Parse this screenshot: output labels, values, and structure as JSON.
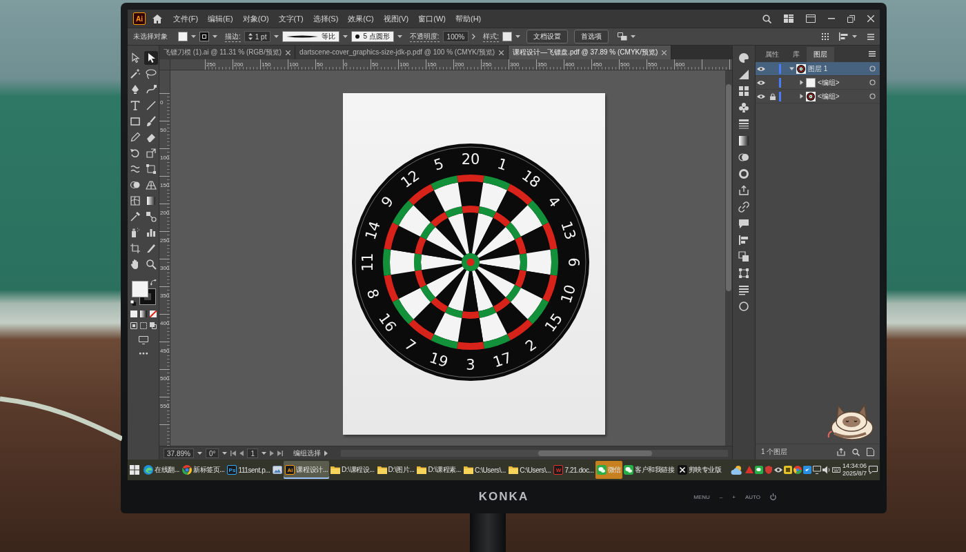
{
  "menubar": {
    "logo": "Ai",
    "menus": [
      "文件(F)",
      "编辑(E)",
      "对象(O)",
      "文字(T)",
      "选择(S)",
      "效果(C)",
      "视图(V)",
      "窗口(W)",
      "帮助(H)"
    ]
  },
  "control_bar": {
    "selection": "未选择对象",
    "stroke_label": "描边:",
    "stroke_weight": "1 pt",
    "stroke_profile": "等比",
    "brush": "5 点圆形",
    "opacity_label": "不透明度:",
    "opacity": "100%",
    "style_label": "样式:",
    "buttons": [
      "文档设置",
      "首选项"
    ]
  },
  "toolbar": {
    "tools": [
      {
        "selected": false
      },
      {
        "selected": true
      },
      {
        "selected": false
      },
      {
        "selected": false
      },
      {
        "selected": false
      },
      {
        "selected": false
      },
      {
        "selected": false
      },
      {
        "selected": false
      },
      {
        "selected": false
      },
      {
        "selected": false
      },
      {
        "selected": false
      },
      {
        "selected": false
      },
      {
        "selected": false
      },
      {
        "selected": false
      },
      {
        "selected": false
      },
      {
        "selected": false
      },
      {
        "selected": false
      },
      {
        "selected": false
      },
      {
        "selected": false
      },
      {
        "selected": false
      },
      {
        "selected": false
      },
      {
        "selected": false
      },
      {
        "selected": false
      },
      {
        "selected": false
      },
      {
        "selected": false
      },
      {
        "selected": false
      },
      {
        "selected": false
      },
      {
        "selected": false
      }
    ]
  },
  "documents": [
    {
      "title": "飞镖刀模 (1).ai @ 11.31 % (RGB/预览)",
      "selected": false
    },
    {
      "title": "dartscene-cover_graphics-size-jdk-p.pdf @ 100 % (CMYK/预览)",
      "selected": false
    },
    {
      "title": "课程设计—飞镖盘.pdf @ 37.89 % (CMYK/预览)",
      "selected": true
    }
  ],
  "rulers": {
    "horizontal": [
      "250",
      "200",
      "150",
      "100",
      "50",
      "0",
      "50",
      "100",
      "150",
      "200",
      "250",
      "300",
      "350",
      "400",
      "450",
      "500",
      "550",
      "600"
    ],
    "vertical": [
      "0",
      "50",
      "100",
      "150",
      "200",
      "250",
      "300",
      "350",
      "400",
      "450",
      "500",
      "550"
    ]
  },
  "artboard": {
    "dartboard_numbers": [
      "20",
      "1",
      "18",
      "4",
      "13",
      "6",
      "10",
      "15",
      "2",
      "17",
      "3",
      "19",
      "7",
      "16",
      "8",
      "11",
      "14",
      "9",
      "12",
      "5"
    ]
  },
  "status_bar": {
    "zoom": "37.89%",
    "rotation": "0°",
    "artboard": "1",
    "tool": "编组选择"
  },
  "layers_panel": {
    "tabs": [
      {
        "label": "属性",
        "selected": false
      },
      {
        "label": "库",
        "selected": false
      },
      {
        "label": "图层",
        "selected": true
      }
    ],
    "layers": [
      {
        "name": "图层 1",
        "color": "#4a7cff",
        "visible": true,
        "locked": false,
        "expanded": true,
        "selected": true,
        "kind": "dartboard",
        "children": [
          {
            "name": "<编组>",
            "visible": true,
            "locked": false,
            "expanded": false,
            "selected": false,
            "kind": "page"
          },
          {
            "name": "<编组>",
            "visible": true,
            "locked": true,
            "expanded": false,
            "selected": false,
            "kind": "dartboard"
          }
        ]
      }
    ],
    "count": "1 个图层"
  },
  "taskbar": {
    "apps": [
      {
        "kind": "swirl",
        "label": "在线翻...",
        "selected": false,
        "attention": false
      },
      {
        "kind": "ring",
        "label": "新标签页...",
        "selected": false,
        "attention": false
      },
      {
        "kind": "badge",
        "badge": "Ps",
        "color": "#31a8ff",
        "label": "111sent.p...",
        "selected": false,
        "attention": false
      },
      {
        "kind": "photos",
        "selected": false,
        "attention": false
      },
      {
        "kind": "badge",
        "badge": "Ai",
        "color": "#ff9a00",
        "label": "课程设计...",
        "selected": true,
        "attention": false
      },
      {
        "kind": "folder",
        "label": "D:\\课程设...",
        "selected": false,
        "attention": false
      },
      {
        "kind": "folder",
        "label": "D:\\图片...",
        "selected": false,
        "attention": false
      },
      {
        "kind": "folder",
        "label": "D:\\课程素...",
        "selected": false,
        "attention": false
      },
      {
        "kind": "folder",
        "label": "C:\\Users\\...",
        "selected": false,
        "attention": false
      },
      {
        "kind": "folder",
        "label": "C:\\Users\\...",
        "selected": false,
        "attention": false
      },
      {
        "kind": "badge",
        "badge": "W",
        "color": "#e0302a",
        "label": "7.21.doc...",
        "selected": false,
        "attention": false
      },
      {
        "kind": "chat",
        "label": "微信",
        "selected": false,
        "attention": true
      },
      {
        "kind": "chat",
        "label": "客户和我链接",
        "selected": false,
        "attention": false
      },
      {
        "kind": "crossed",
        "label": "剪映专业版",
        "selected": false,
        "attention": false
      }
    ],
    "time": "14:34:06",
    "date": "2025/8/7"
  },
  "monitor": {
    "brand": "KONKA",
    "buttons": [
      "MENU",
      "–",
      "+",
      "AUTO"
    ]
  }
}
